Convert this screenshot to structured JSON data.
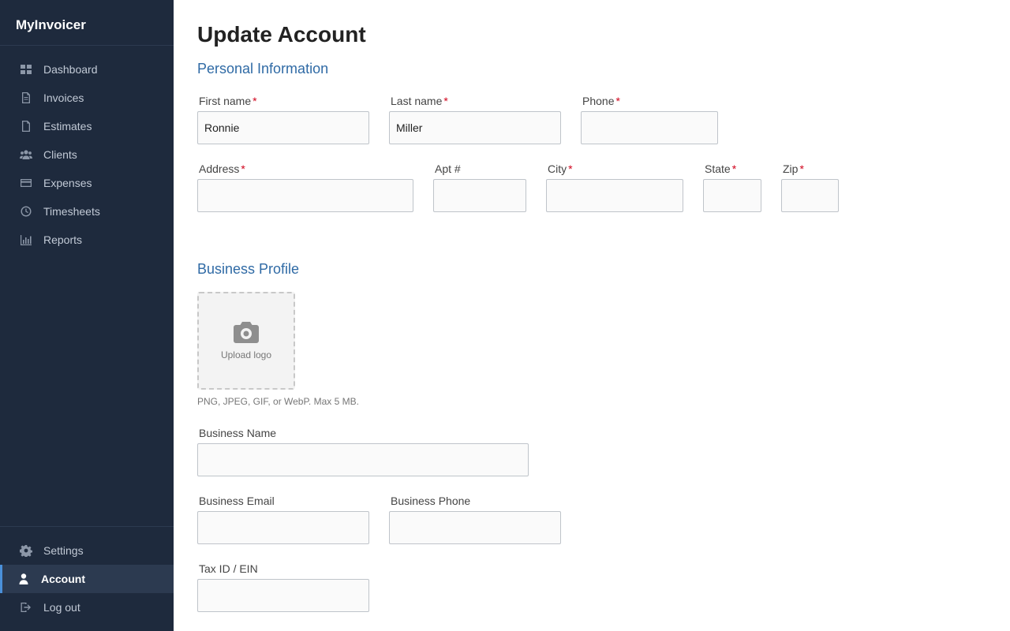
{
  "app": {
    "brand": "MyInvoicer"
  },
  "sidebar": {
    "items": [
      {
        "label": "Dashboard",
        "icon": "dashboard-icon"
      },
      {
        "label": "Invoices",
        "icon": "invoice-icon"
      },
      {
        "label": "Estimates",
        "icon": "estimate-icon"
      },
      {
        "label": "Clients",
        "icon": "clients-icon"
      },
      {
        "label": "Expenses",
        "icon": "credit-card-icon"
      },
      {
        "label": "Timesheets",
        "icon": "clock-icon"
      },
      {
        "label": "Reports",
        "icon": "bar-chart-icon"
      }
    ],
    "bottom_items": [
      {
        "label": "Settings",
        "icon": "gear-icon"
      },
      {
        "label": "Account",
        "icon": "user-icon",
        "active": true
      },
      {
        "label": "Log out",
        "icon": "logout-icon"
      }
    ]
  },
  "page": {
    "title": "Update Account",
    "personal_section": "Personal Information",
    "business_section": "Business Profile"
  },
  "fields": {
    "first_name": {
      "label": "First name",
      "value": "Ronnie",
      "required": "*"
    },
    "last_name": {
      "label": "Last name",
      "value": "Miller",
      "required": "*"
    },
    "phone": {
      "label": "Phone",
      "value": "",
      "required": "*"
    },
    "address": {
      "label": "Address",
      "value": "",
      "required": "*"
    },
    "apt": {
      "label": "Apt #",
      "value": ""
    },
    "city": {
      "label": "City",
      "value": "",
      "required": "*"
    },
    "state": {
      "label": "State",
      "value": "",
      "required": "*"
    },
    "zip": {
      "label": "Zip",
      "value": "",
      "required": "*"
    },
    "business_name": {
      "label": "Business Name",
      "value": ""
    },
    "business_email": {
      "label": "Business Email",
      "value": ""
    },
    "business_phone": {
      "label": "Business Phone",
      "value": ""
    },
    "tax_id": {
      "label": "Tax ID / EIN",
      "value": ""
    }
  },
  "upload": {
    "label": "Upload logo",
    "icon": "camera-icon",
    "hint": "PNG, JPEG, GIF, or WebP. Max 5 MB."
  },
  "colors": {
    "sidebar_bg": "#1e2a3d",
    "section_title": "#2f6aa5",
    "required": "#d0021b",
    "active_accent": "#4a90d9"
  }
}
